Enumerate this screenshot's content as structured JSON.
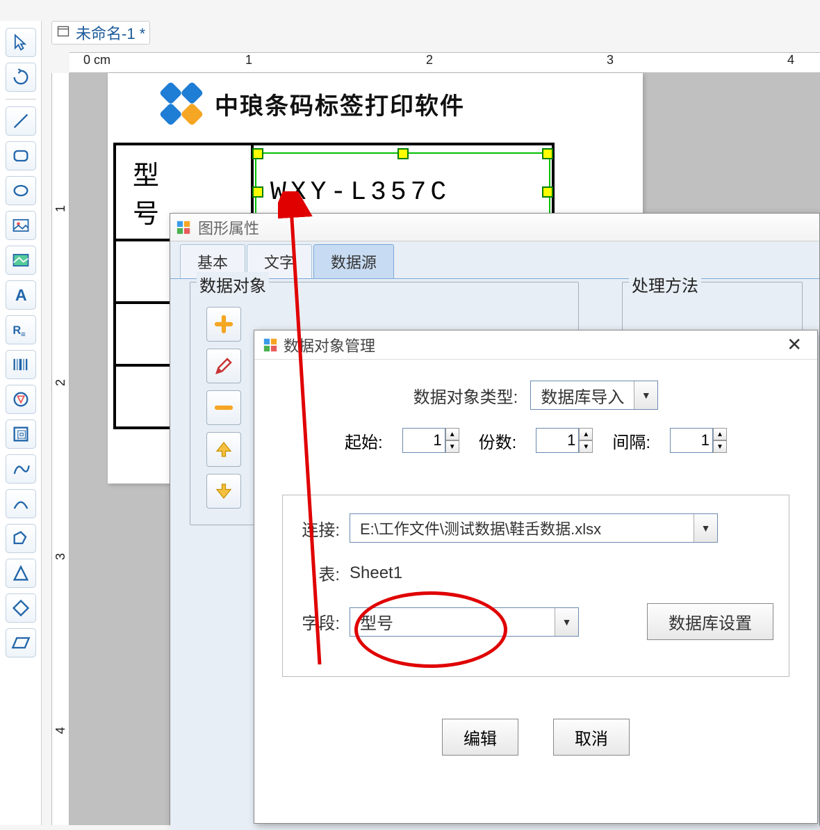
{
  "tab": {
    "title": "未命名-1 *"
  },
  "ruler": {
    "unit": "0 cm",
    "marks_h": [
      "1",
      "2",
      "3",
      "4"
    ],
    "marks_v": [
      "1",
      "2",
      "3",
      "4"
    ]
  },
  "page": {
    "logo_text": "中琅条码标签打印软件",
    "table_label": "型号",
    "selected_value": "WXY-L357C"
  },
  "dialog1": {
    "title": "图形属性",
    "tabs": {
      "basic": "基本",
      "text": "文字",
      "datasource": "数据源"
    },
    "data_object_label": "数据对象",
    "process_method_label": "处理方法"
  },
  "dialog2": {
    "title": "数据对象管理",
    "type_label": "数据对象类型:",
    "type_value": "数据库导入",
    "start_label": "起始:",
    "start_value": "1",
    "copies_label": "份数:",
    "copies_value": "1",
    "interval_label": "间隔:",
    "interval_value": "1",
    "connect_label": "连接:",
    "connect_value": "E:\\工作文件\\测试数据\\鞋舌数据.xlsx",
    "table_label": "表:",
    "table_value": "Sheet1",
    "field_label": "字段:",
    "field_value": "型号",
    "db_settings_btn": "数据库设置",
    "edit_btn": "编辑",
    "cancel_btn": "取消"
  },
  "tools": [
    "pointer",
    "rotate",
    "line",
    "rounded-rect",
    "ellipse",
    "image",
    "picture",
    "text",
    "ruler",
    "barcode",
    "qrcode",
    "path",
    "curve",
    "arc",
    "polygon",
    "triangle",
    "diamond",
    "parallelogram"
  ]
}
